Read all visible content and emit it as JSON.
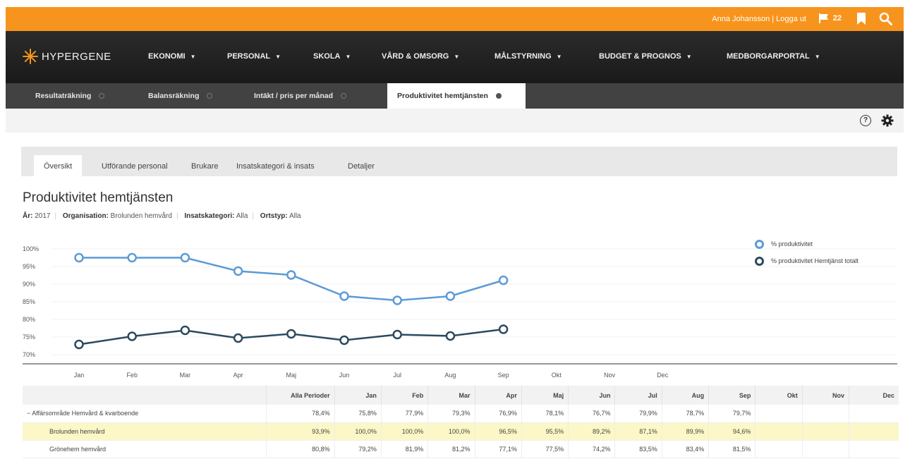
{
  "topbar": {
    "user_text": "Anna Johansson | Logga ut",
    "flag_count": "22",
    "accent": "#f7941d"
  },
  "logo": {
    "text": "HYPERGENE"
  },
  "nav": [
    {
      "label": "EKONOMI"
    },
    {
      "label": "PERSONAL"
    },
    {
      "label": "SKOLA"
    },
    {
      "label": "VÅRD & OMSORG"
    },
    {
      "label": "MÅLSTYRNING"
    },
    {
      "label": "BUDGET & PROGNOS"
    },
    {
      "label": "MEDBORGARPORTAL"
    }
  ],
  "page_tabs": [
    {
      "label": "Resultaträkning"
    },
    {
      "label": "Balansräkning"
    },
    {
      "label": "Intäkt / pris per månad"
    },
    {
      "label": "Produktivitet hemtjänsten",
      "active": true
    }
  ],
  "sub_tabs": [
    {
      "label": "Översikt",
      "active": true
    },
    {
      "label": "Utförande personal"
    },
    {
      "label": "Brukare"
    },
    {
      "label": "Insatskategori & insats"
    },
    {
      "label": "Detaljer"
    }
  ],
  "page": {
    "title": "Produktivitet hemtjänsten",
    "filters": {
      "year_label": "År:",
      "year": "2017",
      "org_label": "Organisation:",
      "org": "Brolunden hemvård",
      "cat_label": "Insatskategori:",
      "cat": "Alla",
      "type_label": "Ortstyp:",
      "type": "Alla"
    }
  },
  "chart_data": {
    "type": "line",
    "categories": [
      "Jan",
      "Feb",
      "Mar",
      "Apr",
      "Maj",
      "Jun",
      "Jul",
      "Aug",
      "Sep",
      "Okt",
      "Nov",
      "Dec"
    ],
    "y_ticks": [
      "100%",
      "95%",
      "90%",
      "85%",
      "80%",
      "75%",
      "70%"
    ],
    "ylim": [
      70,
      100
    ],
    "series": [
      {
        "name": "% produktivitet",
        "color": "#5b9bd5",
        "values": [
          97.5,
          97.5,
          97.5,
          93.7,
          92.6,
          86.6,
          85.4,
          86.6,
          91.1
        ]
      },
      {
        "name": "% produktivitet Hemtjänst totalt",
        "color": "#2c4a5e",
        "values": [
          72.9,
          75.2,
          76.9,
          74.7,
          75.9,
          74.1,
          75.7,
          75.3,
          77.2
        ]
      }
    ]
  },
  "table": {
    "headers": [
      "",
      "Alla Perioder",
      "Jan",
      "Feb",
      "Mar",
      "Apr",
      "Maj",
      "Jun",
      "Jul",
      "Aug",
      "Sep",
      "Okt",
      "Nov",
      "Dec"
    ],
    "rows": [
      {
        "label": "−  Affärsområde Hemvård & kvarboende",
        "level": 0,
        "highlight": false,
        "cells": [
          "78,4%",
          "75,8%",
          "77,9%",
          "79,3%",
          "76,9%",
          "78,1%",
          "76,7%",
          "79,9%",
          "78,7%",
          "79,7%",
          "",
          "",
          ""
        ]
      },
      {
        "label": "Brolunden hemvård",
        "level": 1,
        "highlight": true,
        "cells": [
          "93,9%",
          "100,0%",
          "100,0%",
          "100,0%",
          "96,5%",
          "95,5%",
          "89,2%",
          "87,1%",
          "89,9%",
          "94,6%",
          "",
          "",
          ""
        ]
      },
      {
        "label": "Grönehem hemvård",
        "level": 1,
        "highlight": false,
        "cells": [
          "80,8%",
          "79,2%",
          "81,9%",
          "81,2%",
          "77,1%",
          "77,5%",
          "74,2%",
          "83,5%",
          "83,4%",
          "81,5%",
          "",
          "",
          ""
        ]
      }
    ]
  }
}
